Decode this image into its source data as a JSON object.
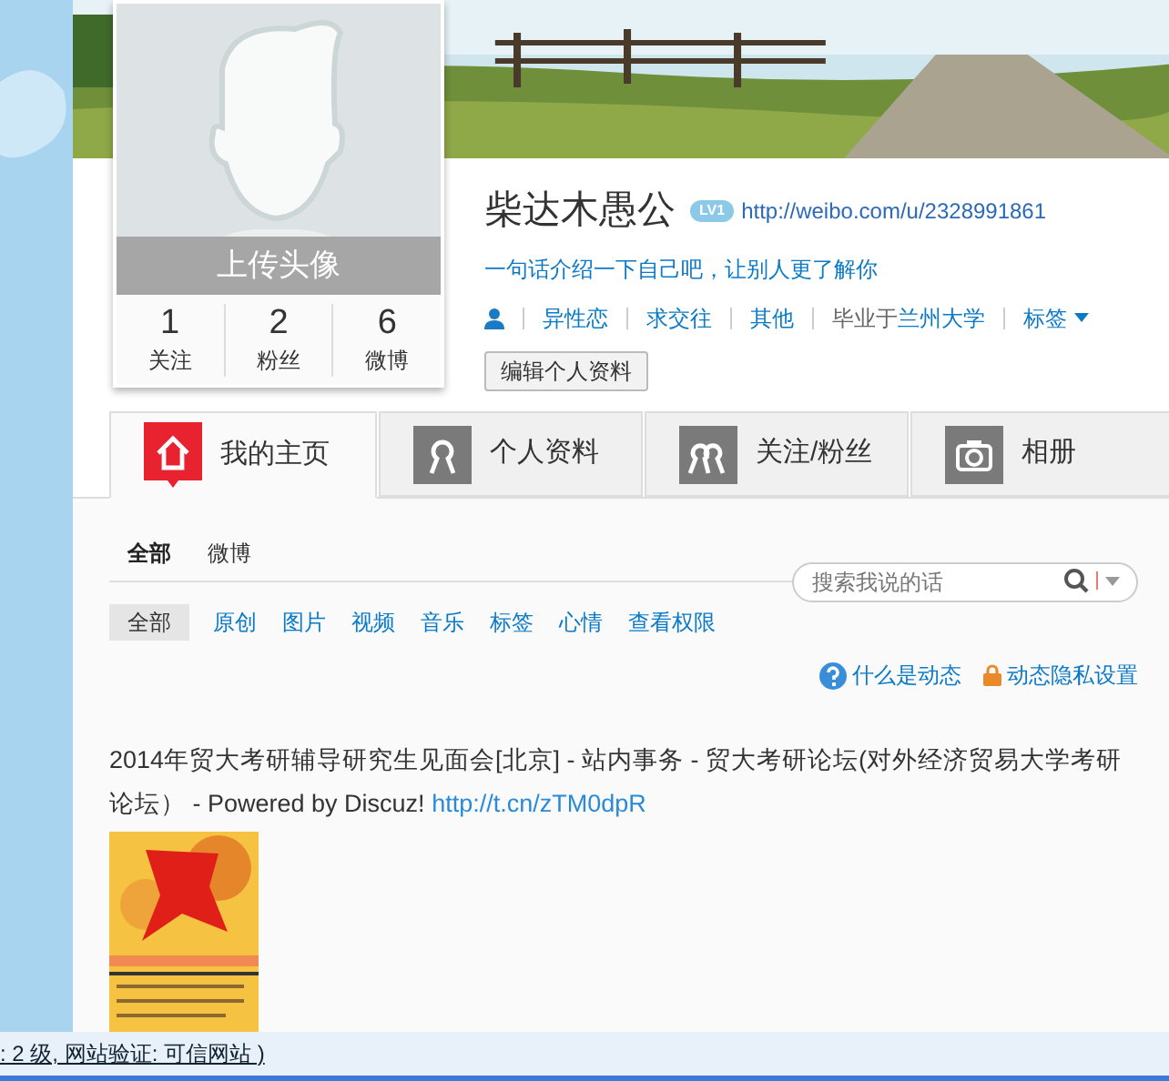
{
  "avatar": {
    "upload_label": "上传头像",
    "stats": [
      {
        "count": "1",
        "label": "关注"
      },
      {
        "count": "2",
        "label": "粉丝"
      },
      {
        "count": "6",
        "label": "微博"
      }
    ]
  },
  "profile": {
    "name": "柴达木愚公",
    "level_badge": "LV1",
    "url": "http://weibo.com/u/2328991861",
    "bio": "一句话介绍一下自己吧，让别人更了解你",
    "details": [
      {
        "kind": "link",
        "text": "异性恋"
      },
      {
        "kind": "link",
        "text": "求交往"
      },
      {
        "kind": "link",
        "text": "其他"
      },
      {
        "kind": "school",
        "prefix": "毕业于",
        "text": "兰州大学"
      },
      {
        "kind": "menu",
        "text": "标签"
      }
    ],
    "edit_button": "编辑个人资料"
  },
  "tabs": [
    {
      "label": "我的主页",
      "kind": "home",
      "selected": true
    },
    {
      "label": "个人资料",
      "kind": "person",
      "selected": false
    },
    {
      "label": "关注/粉丝",
      "kind": "people",
      "selected": false
    },
    {
      "label": "相册",
      "kind": "camera",
      "selected": false
    }
  ],
  "feed_tabs": [
    {
      "label": "全部",
      "selected": true
    },
    {
      "label": "微博",
      "selected": false
    }
  ],
  "search": {
    "placeholder": "搜索我说的话"
  },
  "filters": [
    {
      "label": "全部",
      "selected": true
    },
    {
      "label": "原创",
      "selected": false
    },
    {
      "label": "图片",
      "selected": false
    },
    {
      "label": "视频",
      "selected": false
    },
    {
      "label": "音乐",
      "selected": false
    },
    {
      "label": "标签",
      "selected": false
    },
    {
      "label": "心情",
      "selected": false
    },
    {
      "label": "查看权限",
      "selected": false
    }
  ],
  "help_links": [
    {
      "kind": "help",
      "text": "什么是动态"
    },
    {
      "kind": "lock",
      "text": "动态隐私设置"
    }
  ],
  "post": {
    "text": "2014年贸大考研辅导研究生见面会[北京] - 站内事务 - 贸大考研论坛(对外经济贸易大学考研论坛） - Powered by Discuz!",
    "link": "http://t.cn/zTM0dpR"
  },
  "status_bar": {
    "text": ": 2 级, 网站验证: 可信网站 )"
  }
}
